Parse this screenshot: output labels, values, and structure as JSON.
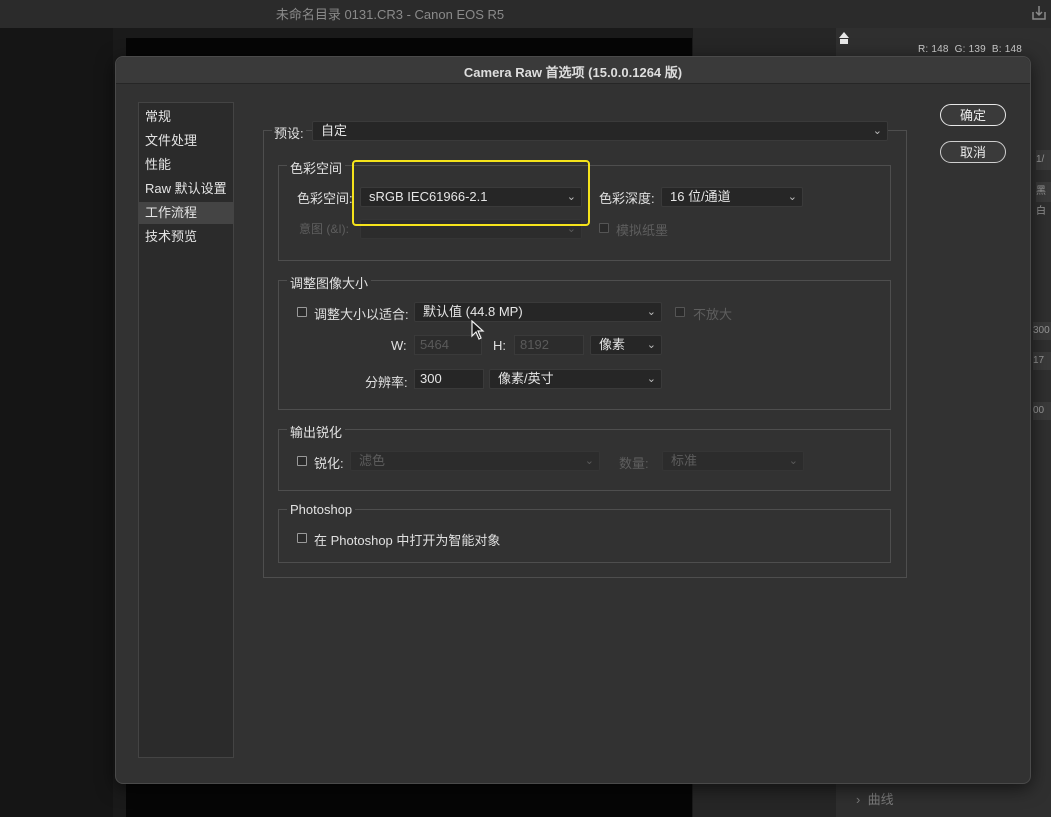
{
  "app": {
    "window_title": "未命名目录 0131.CR3 -  Canon EOS R5",
    "rgb_readout": {
      "r": "R: 148",
      "g": "G: 139",
      "b": "B: 148"
    },
    "curve_panel": "曲线",
    "side_fragments": [
      "1/",
      "黑白",
      "300",
      "17",
      "00"
    ]
  },
  "dialog": {
    "title": "Camera Raw 首选项 (15.0.0.1264 版)",
    "nav": [
      {
        "label": "常规",
        "selected": false
      },
      {
        "label": "文件处理",
        "selected": false
      },
      {
        "label": "性能",
        "selected": false
      },
      {
        "label": "Raw 默认设置",
        "selected": false
      },
      {
        "label": "工作流程",
        "selected": true
      },
      {
        "label": "技术预览",
        "selected": false
      }
    ],
    "buttons": {
      "ok": "确定",
      "cancel": "取消"
    },
    "preset": {
      "label": "预设:",
      "value": "自定"
    },
    "color_space": {
      "title": "色彩空间",
      "space_label": "色彩空间:",
      "space_value": "sRGB IEC61966-2.1",
      "depth_label": "色彩深度:",
      "depth_value": "16 位/通道",
      "intent_label": "意图 (&I):",
      "intent_value": "",
      "simulate_label": "模拟纸墨"
    },
    "resize": {
      "title": "调整图像大小",
      "fit_label": "调整大小以适合:",
      "fit_value": "默认值 (44.8 MP)",
      "no_enlarge_label": "不放大",
      "w_label": "W:",
      "w_value": "5464",
      "h_label": "H:",
      "h_value": "8192",
      "unit_value": "像素",
      "resolution_label": "分辨率:",
      "resolution_value": "300",
      "res_unit_value": "像素/英寸"
    },
    "sharpen": {
      "title": "输出锐化",
      "sharpen_label": "锐化:",
      "sharpen_value": "滤色",
      "amount_label": "数量:",
      "amount_value": "标准"
    },
    "photoshop": {
      "title": "Photoshop",
      "smart_object_label": "在 Photoshop 中打开为智能对象"
    }
  },
  "colors": {
    "highlight": "#f5e31b",
    "dialog_bg": "#323232"
  }
}
